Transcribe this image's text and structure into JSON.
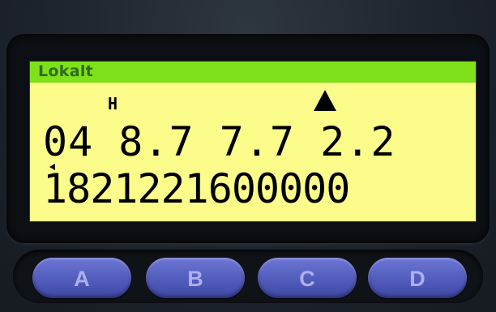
{
  "display": {
    "title": "Lokalt",
    "indicator_h": "H",
    "values_row": "04 8.7 7.7 2.2",
    "number_row": "1821221600000"
  },
  "buttons": [
    {
      "label": "A"
    },
    {
      "label": "B"
    },
    {
      "label": "C"
    },
    {
      "label": "D"
    }
  ],
  "colors": {
    "lcd_background": "#fbfc8a",
    "title_bar": "#7ee119",
    "title_text": "#2f6b1e",
    "button": "#5660bf",
    "button_text": "#aab0ef"
  },
  "icons": {
    "indicator": "up-triangle-icon",
    "cursor": "left-pointer-icon"
  }
}
